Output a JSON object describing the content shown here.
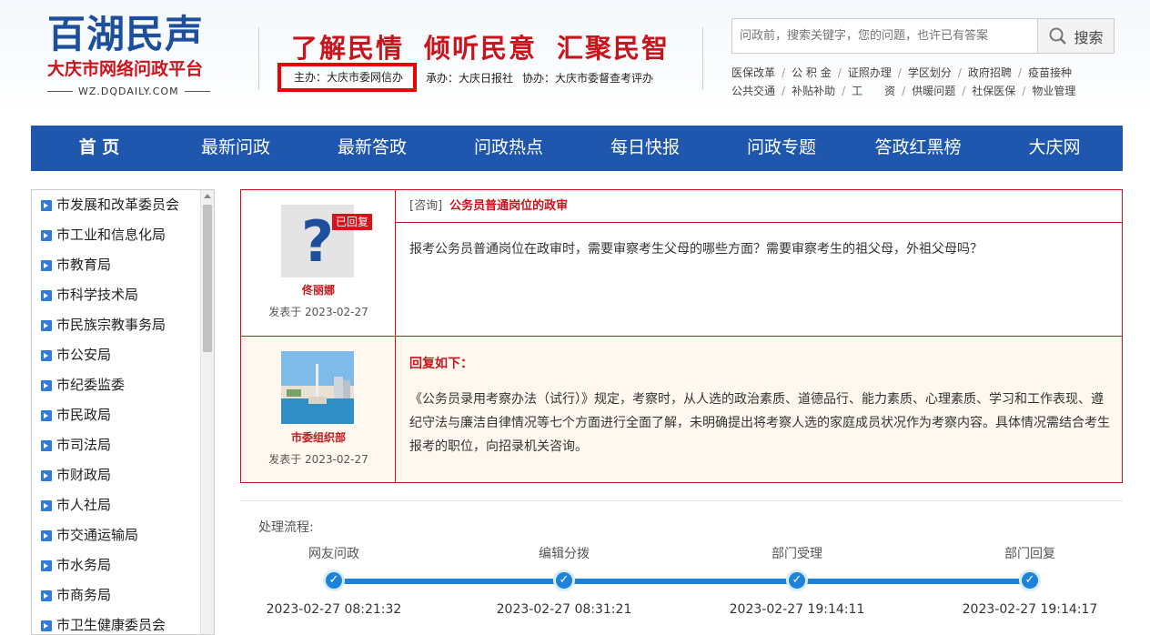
{
  "logo": {
    "main": "百湖民声",
    "sub": "大庆市网络问政平台",
    "url": "WZ.DQDAILY.COM"
  },
  "slogan": [
    "了解民情",
    "倾听民意",
    "汇聚民智"
  ],
  "sponsors": {
    "host": "主办：大庆市委网信办",
    "undertaker": "承办：大庆日报社",
    "assist": "协办：大庆市委督查考评办"
  },
  "search": {
    "placeholder": "问政前，搜索关键字，您的问题，也许已有答案",
    "button": "搜索"
  },
  "quick_links": {
    "row1": [
      "医保改革",
      "公 积 金",
      "证照办理",
      "学区划分",
      "政府招聘",
      "疫苗接种"
    ],
    "row2": [
      "公共交通",
      "补贴补助",
      "工　　资",
      "供暖问题",
      "社保医保",
      "物业管理"
    ]
  },
  "nav": [
    "首 页",
    "最新问政",
    "最新答政",
    "问政热点",
    "每日快报",
    "问政专题",
    "答政红黑榜",
    "大庆网"
  ],
  "departments": [
    "市发展和改革委员会",
    "市工业和信息化局",
    "市教育局",
    "市科学技术局",
    "市民族宗教事务局",
    "市公安局",
    "市纪委监委",
    "市民政局",
    "市司法局",
    "市财政局",
    "市人社局",
    "市交通运输局",
    "市水务局",
    "市商务局",
    "市卫生健康委员会"
  ],
  "question": {
    "badge": "已回复",
    "author": "佟丽娜",
    "date": "发表于 2023-02-27",
    "tag": "[咨询]",
    "title": "公务员普通岗位的政审",
    "text": "报考公务员普通岗位在政审时，需要审察考生父母的哪些方面？需要审察考生的祖父母，外祖父母吗？"
  },
  "answer": {
    "author": "市委组织部",
    "date": "发表于 2023-02-27",
    "title": "回复如下：",
    "text": "《公务员录用考察办法（试行）》规定，考察时，从人选的政治素质、道德品行、能力素质、心理素质、学习和工作表现、遵纪守法与廉洁自律情况等七个方面进行全面了解，未明确提出将考察人选的家庭成员状况作为考察内容。具体情况需结合考生报考的职位，向招录机关咨询。"
  },
  "flow": {
    "label": "处理流程:",
    "steps": [
      {
        "name": "网友问政",
        "time": "2023-02-27 08:21:32"
      },
      {
        "name": "编辑分拨",
        "time": "2023-02-27 08:31:21"
      },
      {
        "name": "部门受理",
        "time": "2023-02-27 19:14:11"
      },
      {
        "name": "部门回复",
        "time": "2023-02-27 19:14:17"
      }
    ]
  }
}
